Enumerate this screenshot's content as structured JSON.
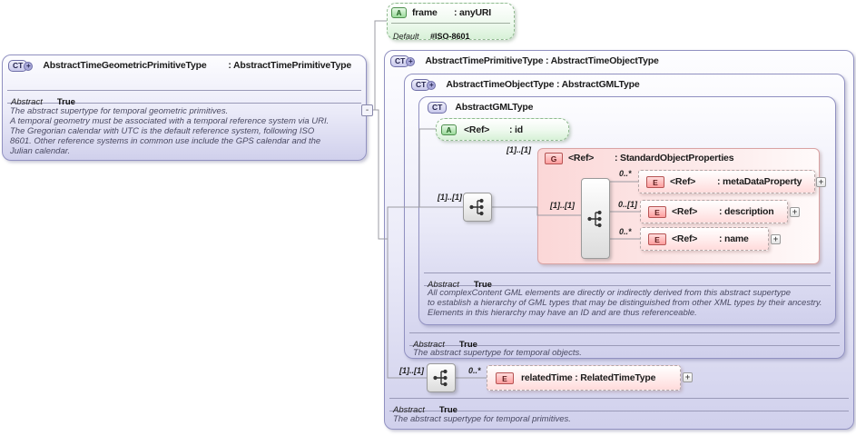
{
  "colors": {
    "lavender_border": "#9191c1",
    "green_border": "#8fb98f",
    "pink_border": "#d9a3a3",
    "element_red": "#b65353",
    "connector": "#9b9ba3"
  },
  "icons": {
    "complex_type": "CT",
    "attribute": "A",
    "element": "E",
    "group": "G",
    "expand": "+",
    "collapse": "-"
  },
  "left_box": {
    "title_name": "AbstractTimeGeometricPrimitiveType",
    "title_type": " : AbstractTimePrimitiveType",
    "abstract_label": "Abstract",
    "abstract_value": "True",
    "doc": "The abstract supertype for temporal geometric primitives.\nA temporal geometry must be associated with a temporal reference system via URI.\nThe Gregorian calendar with UTC is the default reference system, following ISO\n8601. Other reference systems in common use include the GPS calendar and the\nJulian calendar."
  },
  "frame_attribute": {
    "name": "frame",
    "type": ": anyURI",
    "default_label": "Default",
    "default_value": "#ISO-8601"
  },
  "primitive_box": {
    "title": "AbstractTimePrimitiveType : AbstractTimeObjectType",
    "sequence_cardinality": "[1]..[1]",
    "related_time": {
      "cardinality": "0..*",
      "name": "relatedTime : RelatedTimeType"
    },
    "abstract_label": "Abstract",
    "abstract_value": "True",
    "doc": "The abstract supertype for temporal primitives."
  },
  "object_box": {
    "title": "AbstractTimeObjectType : AbstractGMLType",
    "abstract_label": "Abstract",
    "abstract_value": "True",
    "doc": "The abstract supertype for temporal objects."
  },
  "gml_box": {
    "title": "AbstractGMLType",
    "id_attribute": {
      "name": "<Ref>",
      "type": ": id"
    },
    "sequence_cardinality": "[1]..[1]",
    "abstract_label": "Abstract",
    "abstract_value": "True",
    "doc": "All complexContent GML elements are directly or indirectly derived from this abstract supertype\nto establish a hierarchy of GML types that may be distinguished from other XML types by their ancestry.\nElements in this hierarchy may have an ID and are thus referenceable."
  },
  "group_box": {
    "cardinality": "[1]..[1]",
    "name": "<Ref>",
    "type": ": StandardObjectProperties",
    "inner_cardinality": "[1]..[1]",
    "elements": [
      {
        "cardinality": "0..*",
        "name": "<Ref>",
        "type": ": metaDataProperty"
      },
      {
        "cardinality": "0..[1]",
        "name": "<Ref>",
        "type": ": description"
      },
      {
        "cardinality": "0..*",
        "name": "<Ref>",
        "type": ": name"
      }
    ]
  }
}
